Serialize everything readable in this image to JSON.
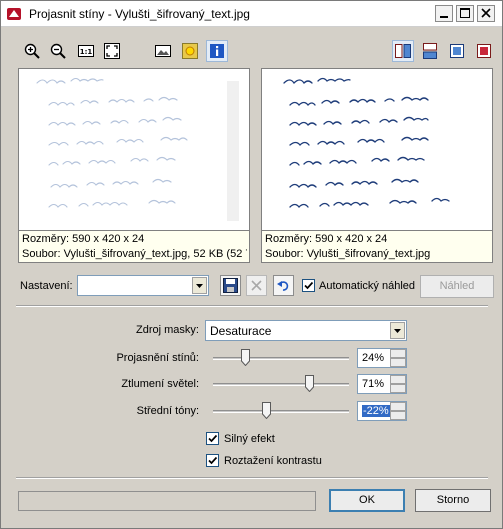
{
  "window": {
    "title": "Projasnit stíny - Vylušti_šifrovaný_text.jpg",
    "controls": [
      "minimize",
      "maximize",
      "close"
    ]
  },
  "toolbar": {
    "left_icons": [
      "zoom-in-icon",
      "zoom-out-icon",
      "actual-size-icon",
      "fit-window-icon",
      "compare-image-icon",
      "sun-icon",
      "info-icon"
    ],
    "right_icons": [
      "split-vertical-icon",
      "split-horizontal-icon",
      "single-view-icon",
      "preview-only-icon"
    ]
  },
  "panes": [
    {
      "info_line1": "Rozměry: 590 x 420 x 24",
      "info_line2": "Soubor: Vylušti_šifrovaný_text.jpg, 52 KB (52 7..."
    },
    {
      "info_line1": "Rozměry: 590 x 420 x 24",
      "info_line2": "Soubor: Vylušti_šifrovaný_text.jpg"
    }
  ],
  "preset": {
    "label": "Nastavení:",
    "value": "",
    "auto_preview_label": "Automatický náhled",
    "auto_preview_checked": true,
    "preview_button": "Náhled"
  },
  "mask": {
    "label": "Zdroj masky:",
    "value": "Desaturace"
  },
  "sliders": [
    {
      "label": "Projasnění stínů:",
      "value": "24%",
      "level": 0.24
    },
    {
      "label": "Ztlumení světel:",
      "value": "71%",
      "level": 0.71
    },
    {
      "label": "Střední tóny:",
      "value": "-22%",
      "level": 0.39
    }
  ],
  "options": [
    {
      "label": "Silný efekt",
      "checked": true
    },
    {
      "label": "Roztažení kontrastu",
      "checked": true
    }
  ],
  "buttons": {
    "ok": "OK",
    "cancel": "Storno"
  },
  "colors": {
    "pane_info_bg": "#ffffef",
    "selection": "#316ac5",
    "dialog_bg": "#d4d0c8"
  }
}
